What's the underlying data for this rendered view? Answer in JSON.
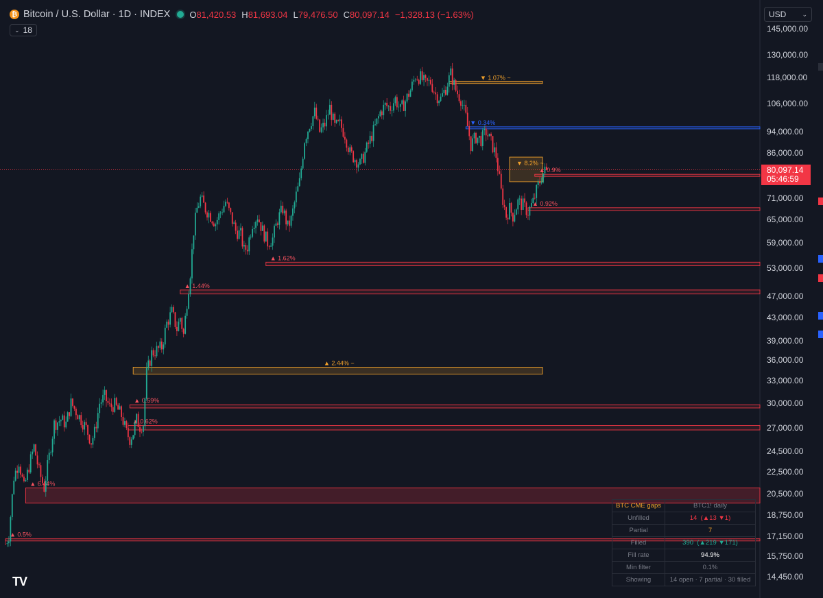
{
  "header": {
    "title": "Bitcoin / U.S. Dollar · 1D · INDEX",
    "ohlc": [
      {
        "k": "O",
        "v": "81,420.53"
      },
      {
        "k": "H",
        "v": "81,693.04"
      },
      {
        "k": "L",
        "v": "79,476.50"
      },
      {
        "k": "C",
        "v": "80,097.14"
      }
    ],
    "change": "−1,328.13 (−1.63%)",
    "indicator_count": "18",
    "currency": "USD"
  },
  "price_label": {
    "price": "80,097.14",
    "countdown": "05:46:59"
  },
  "colors": {
    "bg": "#131722",
    "up": "#22ab94",
    "down": "#f23645",
    "orange": "#f0a02b",
    "blue": "#2962ff",
    "grid": "#2a2e39"
  },
  "chart_data": {
    "type": "candlestick",
    "title": "Bitcoin / U.S. Dollar",
    "scale": "log",
    "ylim": [
      13500,
      160000
    ],
    "yticks": [
      145000,
      130000,
      118000,
      106000,
      94000,
      86000,
      71000,
      65000,
      59000,
      53000,
      47000,
      43000,
      39000,
      36000,
      33000,
      30000,
      27000,
      24500,
      22500,
      20500,
      18750,
      17150,
      15750,
      14450
    ],
    "ytick_labels": [
      "145,000.00",
      "130,000.00",
      "118,000.00",
      "106,000.00",
      "94,000.00",
      "86,000.00",
      "71,000.00",
      "65,000.00",
      "59,000.00",
      "53,000.00",
      "47,000.00",
      "43,000.00",
      "39,000.00",
      "36,000.00",
      "33,000.00",
      "30,000.00",
      "27,000.00",
      "24,500.00",
      "22,500.00",
      "20,500.00",
      "18,750.00",
      "17,150.00",
      "15,750.00",
      "14,450.00"
    ],
    "last_price": 80097.14,
    "path": [
      [
        0,
        16600
      ],
      [
        2,
        17200
      ],
      [
        5,
        22000
      ],
      [
        8,
        23500
      ],
      [
        11,
        21000
      ],
      [
        14,
        23000
      ],
      [
        17,
        25000
      ],
      [
        20,
        22500
      ],
      [
        23,
        21000
      ],
      [
        26,
        24000
      ],
      [
        29,
        27500
      ],
      [
        33,
        28000
      ],
      [
        36,
        27500
      ],
      [
        39,
        30000
      ],
      [
        42,
        29000
      ],
      [
        45,
        28000
      ],
      [
        48,
        27000
      ],
      [
        51,
        25500
      ],
      [
        53,
        26500
      ],
      [
        56,
        30000
      ],
      [
        59,
        30800
      ],
      [
        62,
        29500
      ],
      [
        65,
        29800
      ],
      [
        69,
        28500
      ],
      [
        72,
        26500
      ],
      [
        74,
        25800
      ],
      [
        76,
        26500
      ],
      [
        78,
        28000
      ],
      [
        80,
        27200
      ],
      [
        82,
        27500
      ],
      [
        84,
        34000
      ],
      [
        87,
        37000
      ],
      [
        90,
        37500
      ],
      [
        93,
        38000
      ],
      [
        96,
        42000
      ],
      [
        99,
        44000
      ],
      [
        102,
        41000
      ],
      [
        104,
        43000
      ],
      [
        106,
        40000
      ],
      [
        108,
        46000
      ],
      [
        110,
        52000
      ],
      [
        112,
        62000
      ],
      [
        114,
        68000
      ],
      [
        116,
        71000
      ],
      [
        119,
        68000
      ],
      [
        122,
        66000
      ],
      [
        125,
        64000
      ],
      [
        128,
        67000
      ],
      [
        131,
        70000
      ],
      [
        134,
        66000
      ],
      [
        137,
        62000
      ],
      [
        140,
        61000
      ],
      [
        142,
        57000
      ],
      [
        144,
        58000
      ],
      [
        147,
        64000
      ],
      [
        150,
        66000
      ],
      [
        153,
        62000
      ],
      [
        156,
        59000
      ],
      [
        159,
        60000
      ],
      [
        162,
        65000
      ],
      [
        165,
        68000
      ],
      [
        168,
        63000
      ],
      [
        170,
        65000
      ],
      [
        173,
        72000
      ],
      [
        175,
        76000
      ],
      [
        178,
        91000
      ],
      [
        181,
        97000
      ],
      [
        184,
        102000
      ],
      [
        187,
        94000
      ],
      [
        190,
        97000
      ],
      [
        193,
        104000
      ],
      [
        196,
        96000
      ],
      [
        199,
        97000
      ],
      [
        202,
        93000
      ],
      [
        205,
        86000
      ],
      [
        208,
        84000
      ],
      [
        211,
        82000
      ],
      [
        214,
        86000
      ],
      [
        217,
        91000
      ],
      [
        220,
        96000
      ],
      [
        223,
        102000
      ],
      [
        226,
        105000
      ],
      [
        229,
        104000
      ],
      [
        232,
        108000
      ],
      [
        235,
        103000
      ],
      [
        238,
        107000
      ],
      [
        241,
        112000
      ],
      [
        244,
        119000
      ],
      [
        247,
        118000
      ],
      [
        250,
        115000
      ],
      [
        253,
        116000
      ],
      [
        256,
        110000
      ],
      [
        259,
        108000
      ],
      [
        262,
        113000
      ],
      [
        265,
        120000
      ],
      [
        268,
        112000
      ],
      [
        271,
        108000
      ],
      [
        274,
        100000
      ],
      [
        277,
        89000
      ],
      [
        280,
        92000
      ],
      [
        283,
        91000
      ],
      [
        286,
        94000
      ],
      [
        289,
        90000
      ],
      [
        292,
        85000
      ],
      [
        295,
        73000
      ],
      [
        298,
        66000
      ],
      [
        300,
        68000
      ],
      [
        302,
        66000
      ],
      [
        305,
        70000
      ],
      [
        308,
        69000
      ],
      [
        311,
        67000
      ],
      [
        314,
        70000
      ],
      [
        317,
        75000
      ],
      [
        320,
        79000
      ],
      [
        322,
        80097
      ]
    ],
    "gaps": [
      {
        "pct": "1.07%",
        "dir": "down",
        "state": "partial",
        "low": 115200,
        "high": 116300,
        "start": 264
      },
      {
        "pct": "0.34%",
        "dir": "down",
        "state": "open",
        "low": 95700,
        "high": 96000,
        "start": 274
      },
      {
        "pct": "8.2%",
        "dir": "down",
        "state": "partial",
        "low": 76200,
        "high": 84500,
        "start": 300
      },
      {
        "pct": "0.9%",
        "dir": "up",
        "state": "open",
        "low": 78000,
        "high": 78600,
        "start": 315
      },
      {
        "pct": "0.92%",
        "dir": "up",
        "state": "open",
        "low": 67500,
        "high": 68300,
        "start": 311
      },
      {
        "pct": "1.62%",
        "dir": "up",
        "state": "open",
        "low": 53500,
        "high": 54300,
        "start": 155
      },
      {
        "pct": "1.44%",
        "dir": "up",
        "state": "open",
        "low": 47500,
        "high": 48300,
        "start": 104
      },
      {
        "pct": "2.44%",
        "dir": "up",
        "state": "partial",
        "low": 33900,
        "high": 34900,
        "start": 76
      },
      {
        "pct": "0.59%",
        "dir": "up",
        "state": "open",
        "low": 29400,
        "high": 29800,
        "start": 74
      },
      {
        "pct": "0.62%",
        "dir": "up",
        "state": "open",
        "low": 26800,
        "high": 27300,
        "start": 73
      },
      {
        "pct": "6.44%",
        "dir": "up",
        "state": "open",
        "low": 19700,
        "high": 21000,
        "start": 12
      },
      {
        "pct": "0.5%",
        "dir": "up",
        "state": "open",
        "low": 16800,
        "high": 16950,
        "start": 0
      }
    ]
  },
  "table": {
    "title": "BTC CME gaps",
    "subtitle": "BTC1! daily",
    "rows": [
      {
        "label": "Unfilled",
        "value": "14",
        "up": "▲13",
        "down": "▼1"
      },
      {
        "label": "Partial",
        "value": "7"
      },
      {
        "label": "Filled",
        "value": "390",
        "up": "▲219",
        "down": "▼171"
      },
      {
        "label": "Fill rate",
        "value": "94.9%"
      },
      {
        "label": "Min filter",
        "value": "0.1%"
      },
      {
        "label": "Showing",
        "value": "14 open · 7 partial · 30 filled"
      }
    ]
  },
  "logo": "TV"
}
